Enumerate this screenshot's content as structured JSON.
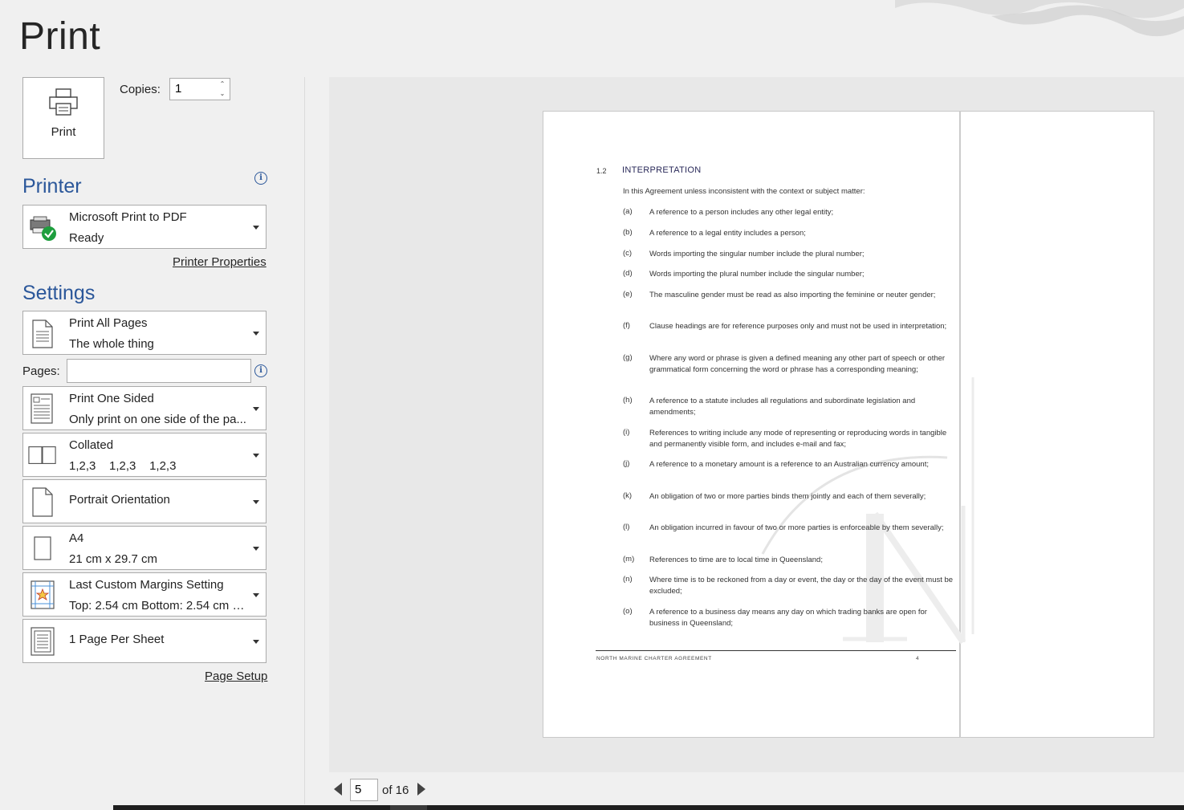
{
  "page": {
    "title": "Print"
  },
  "print_button": {
    "label": "Print",
    "icon": "printer-icon"
  },
  "copies": {
    "label": "Copies:",
    "value": "1"
  },
  "printer": {
    "heading": "Printer",
    "name": "Microsoft Print to PDF",
    "status": "Ready",
    "properties_link": "Printer Properties"
  },
  "settings": {
    "heading": "Settings",
    "print_range": {
      "title": "Print All Pages",
      "subtitle": "The whole thing"
    },
    "pages": {
      "label": "Pages:",
      "value": ""
    },
    "sides": {
      "title": "Print One Sided",
      "subtitle": "Only print on one side of the pa..."
    },
    "collation": {
      "title": "Collated",
      "subtitle": "1,2,3    1,2,3    1,2,3"
    },
    "orientation": {
      "title": "Portrait Orientation"
    },
    "paper_size": {
      "title": "A4",
      "subtitle": "21 cm x 29.7 cm"
    },
    "margins": {
      "title": "Last Custom Margins Setting",
      "subtitle": "Top: 2.54 cm Bottom: 2.54 cm L..."
    },
    "pages_per_sheet": {
      "title": "1 Page Per Sheet"
    },
    "page_setup_link": "Page Setup"
  },
  "preview": {
    "section_number": "1.2",
    "section_heading": "INTERPRETATION",
    "intro": "In this Agreement unless inconsistent with the context or subject matter:",
    "clauses": [
      {
        "letter": "(a)",
        "text": "A reference to a person includes any other legal entity;"
      },
      {
        "letter": "(b)",
        "text": "A reference to a legal entity includes a person;"
      },
      {
        "letter": "(c)",
        "text": "Words importing the singular number include the plural number;"
      },
      {
        "letter": "(d)",
        "text": "Words importing the plural number include the singular number;"
      },
      {
        "letter": "(e)",
        "text": "The masculine gender must be read as also importing the feminine or neuter gender;"
      },
      {
        "letter": "(f)",
        "text": "Clause headings are for reference purposes only and must not be used in interpretation;"
      },
      {
        "letter": "(g)",
        "text": "Where any word or phrase is given a defined meaning any other part of speech or other grammatical form concerning the word or phrase has a corresponding meaning;"
      },
      {
        "letter": "(h)",
        "text": "A reference to a statute includes all regulations and subordinate legislation and amendments;"
      },
      {
        "letter": "(i)",
        "text": "References to writing include any mode of representing or reproducing words in tangible and permanently visible form, and includes e-mail and fax;"
      },
      {
        "letter": "(j)",
        "text": "A reference to a monetary amount is a reference to an Australian currency amount;"
      },
      {
        "letter": "(k)",
        "text": "An obligation of two or more parties binds them jointly and each of them severally;"
      },
      {
        "letter": "(l)",
        "text": "An obligation incurred in favour of two or more parties is enforceable by them severally;"
      },
      {
        "letter": "(m)",
        "text": "References to time are to local time in Queensland;"
      },
      {
        "letter": "(n)",
        "text": "Where time is to be reckoned from a day or event, the day or the day of the event must be excluded;"
      },
      {
        "letter": "(o)",
        "text": "A reference to a business day means any day on which trading banks are open for business in Queensland;"
      }
    ],
    "footer_text": "NORTH MARINE CHARTER AGREEMENT",
    "footer_page": "4"
  },
  "navigation": {
    "current_page": "5",
    "total_label": "of 16"
  }
}
